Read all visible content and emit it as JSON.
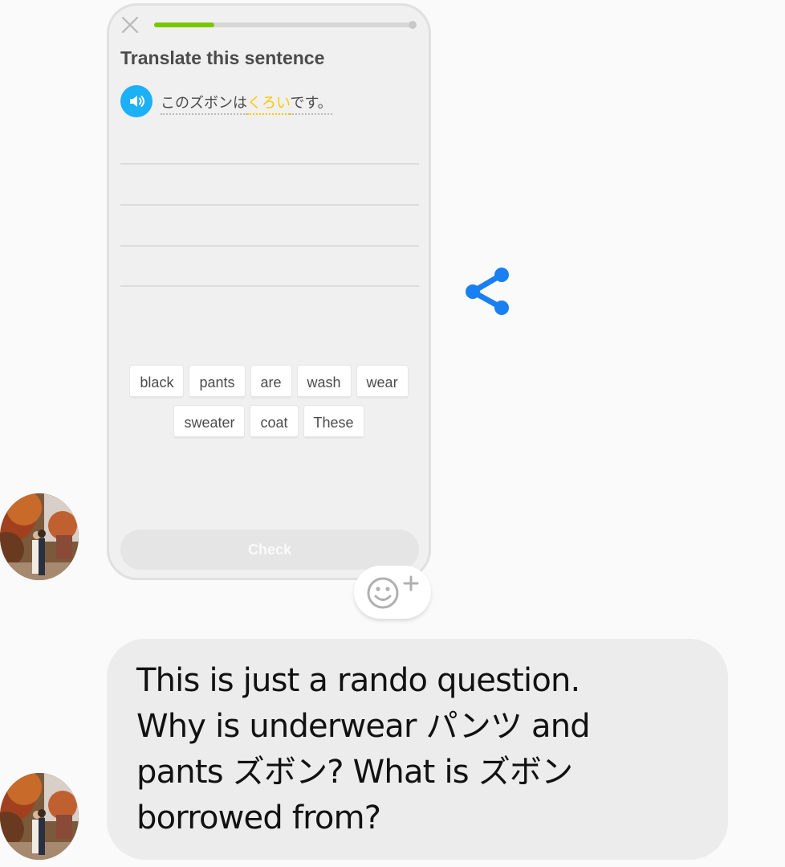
{
  "lesson": {
    "progress": 0.23,
    "prompt_title": "Translate this sentence",
    "sentence_parts": [
      "このズボンは",
      "くろい",
      "です。"
    ],
    "word_bank_rows": [
      [
        "black",
        "pants",
        "are",
        "wash",
        "wear"
      ],
      [
        "sweater",
        "coat",
        "These"
      ]
    ],
    "check_label": "Check",
    "accent_green": "#78c800",
    "speaker_blue": "#1cb0f6",
    "highlight_yellow": "#ffc800"
  },
  "share": {
    "icon": "share-icon",
    "color": "#1a7ff0"
  },
  "reaction": {
    "icon": "add-reaction-icon"
  },
  "message": {
    "lines": [
      "This is just a rando question.",
      "Why is underwear パンツ and",
      "pants ズボン? What is ズボン",
      "borrowed from?"
    ]
  }
}
